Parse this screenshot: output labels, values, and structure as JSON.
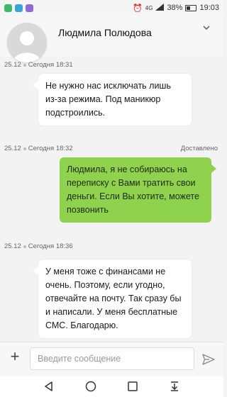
{
  "status_bar": {
    "network": "4G",
    "battery": "38%",
    "time": "19:03"
  },
  "header": {
    "contact_name": "Людмила Полюдова"
  },
  "messages": [
    {
      "date": "25.12",
      "time": "Сегодня 18:31",
      "direction": "in",
      "text": "Не нужно нас исключать лишь из-за режима. Под маникюр подстроились."
    },
    {
      "date": "25.12",
      "time": "Сегодня 18:32",
      "status": "Доставлено",
      "direction": "out",
      "text": "Людмила, я не собираюсь на переписку с Вами тратить свои деньги. Если Вы хотите, можете позвонить"
    },
    {
      "date": "25.12",
      "time": "Сегодня 18:36",
      "direction": "in",
      "text": "У меня тоже с финансами не очень. Поэтому, если угодно, отвечайте на почту. Так сразу бы и написали. У меня бесплатные СМС. Благодарю."
    }
  ],
  "composer": {
    "placeholder": "Введите сообщение"
  },
  "colors": {
    "outgoing_bubble": "#8fd24e",
    "incoming_bubble": "#ffffff",
    "background": "#f3f3f3"
  }
}
